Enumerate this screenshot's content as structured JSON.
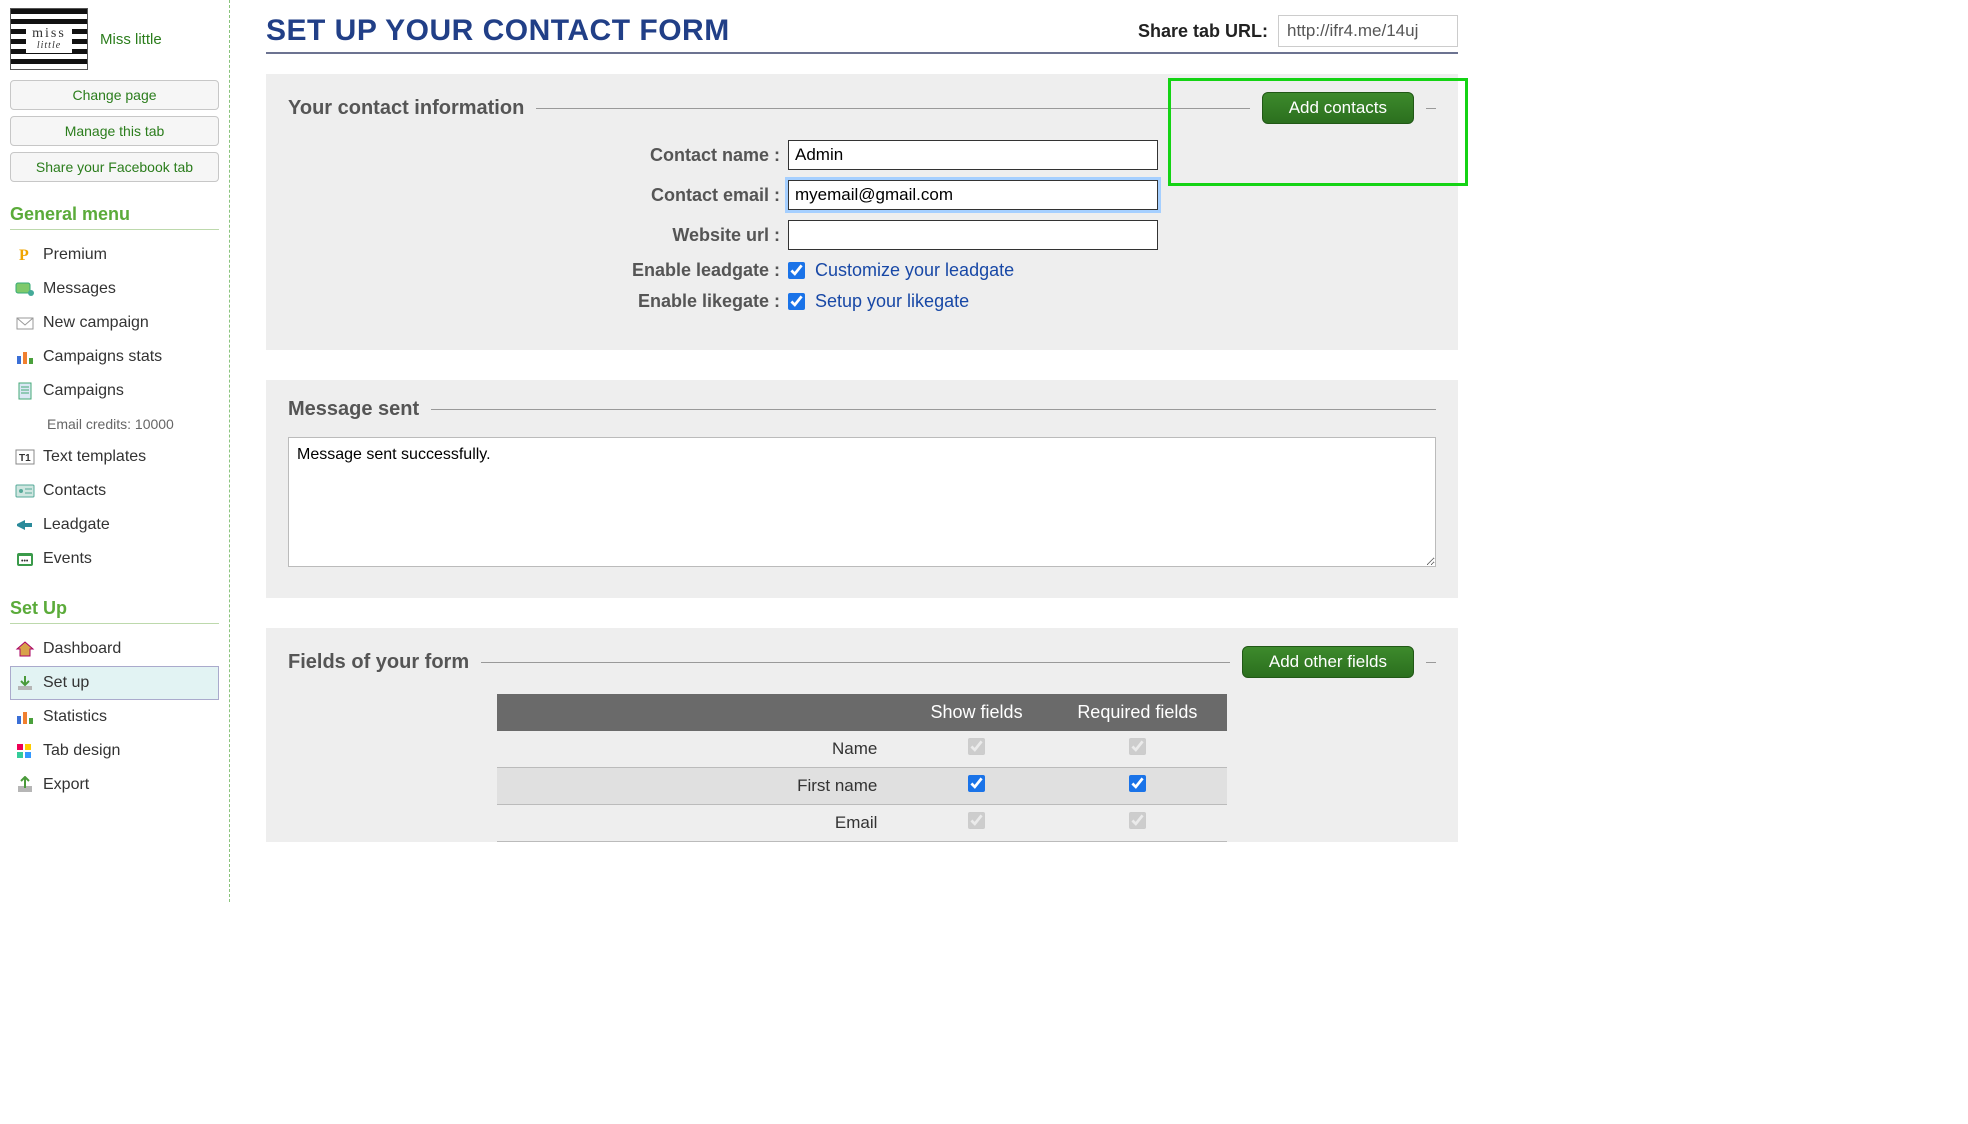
{
  "site": {
    "name": "Miss little",
    "logo_top": "miss",
    "logo_bottom": "little"
  },
  "sideButtons": [
    "Change page",
    "Manage this tab",
    "Share your Facebook tab"
  ],
  "menus": {
    "general": {
      "title": "General menu",
      "items": [
        {
          "id": "premium",
          "label": "Premium",
          "icon": "p"
        },
        {
          "id": "messages",
          "label": "Messages",
          "icon": "msg"
        },
        {
          "id": "newcamp",
          "label": "New campaign",
          "icon": "mail"
        },
        {
          "id": "stats",
          "label": "Campaigns stats",
          "icon": "bars"
        },
        {
          "id": "campaigns",
          "label": "Campaigns",
          "icon": "doc"
        },
        {
          "id": "credits",
          "label": "Email credits: 10000",
          "icon": "",
          "sub": true
        },
        {
          "id": "templates",
          "label": "Text templates",
          "icon": "tt"
        },
        {
          "id": "contacts",
          "label": "Contacts",
          "icon": "card"
        },
        {
          "id": "leadgate",
          "label": "Leadgate",
          "icon": "horn"
        },
        {
          "id": "events",
          "label": "Events",
          "icon": "ev"
        }
      ]
    },
    "setup": {
      "title": "Set Up",
      "items": [
        {
          "id": "dashboard",
          "label": "Dashboard",
          "icon": "home"
        },
        {
          "id": "setup",
          "label": "Set up",
          "icon": "dl",
          "sel": true
        },
        {
          "id": "statistics",
          "label": "Statistics",
          "icon": "bars2"
        },
        {
          "id": "tabdesign",
          "label": "Tab design",
          "icon": "grid"
        },
        {
          "id": "export",
          "label": "Export",
          "icon": "exp"
        }
      ]
    }
  },
  "page": {
    "title": "SET UP YOUR CONTACT FORM",
    "share_label": "Share tab URL:",
    "share_url": "http://ifr4.me/14uj"
  },
  "contactPanel": {
    "title": "Your contact information",
    "add_btn": "Add contacts",
    "name_label": "Contact name :",
    "name_value": "Admin",
    "email_label": "Contact email :",
    "email_value": "myemail@gmail.com",
    "url_label": "Website url :",
    "url_value": "",
    "leadgate_label": "Enable leadgate :",
    "leadgate_link": "Customize your leadgate",
    "likegate_label": "Enable likegate :",
    "likegate_link": "Setup your likegate"
  },
  "messagePanel": {
    "title": "Message sent",
    "text": "Message sent successfully."
  },
  "fieldsPanel": {
    "title": "Fields of your form",
    "add_btn": "Add other fields",
    "th_name": "",
    "th_show": "Show fields",
    "th_req": "Required fields",
    "rows": [
      {
        "label": "Name",
        "show": true,
        "show_disabled": true,
        "req": true,
        "req_disabled": true
      },
      {
        "label": "First name",
        "show": true,
        "show_disabled": false,
        "req": true,
        "req_disabled": false,
        "alt": true
      },
      {
        "label": "Email",
        "show": true,
        "show_disabled": true,
        "req": true,
        "req_disabled": true
      }
    ]
  }
}
